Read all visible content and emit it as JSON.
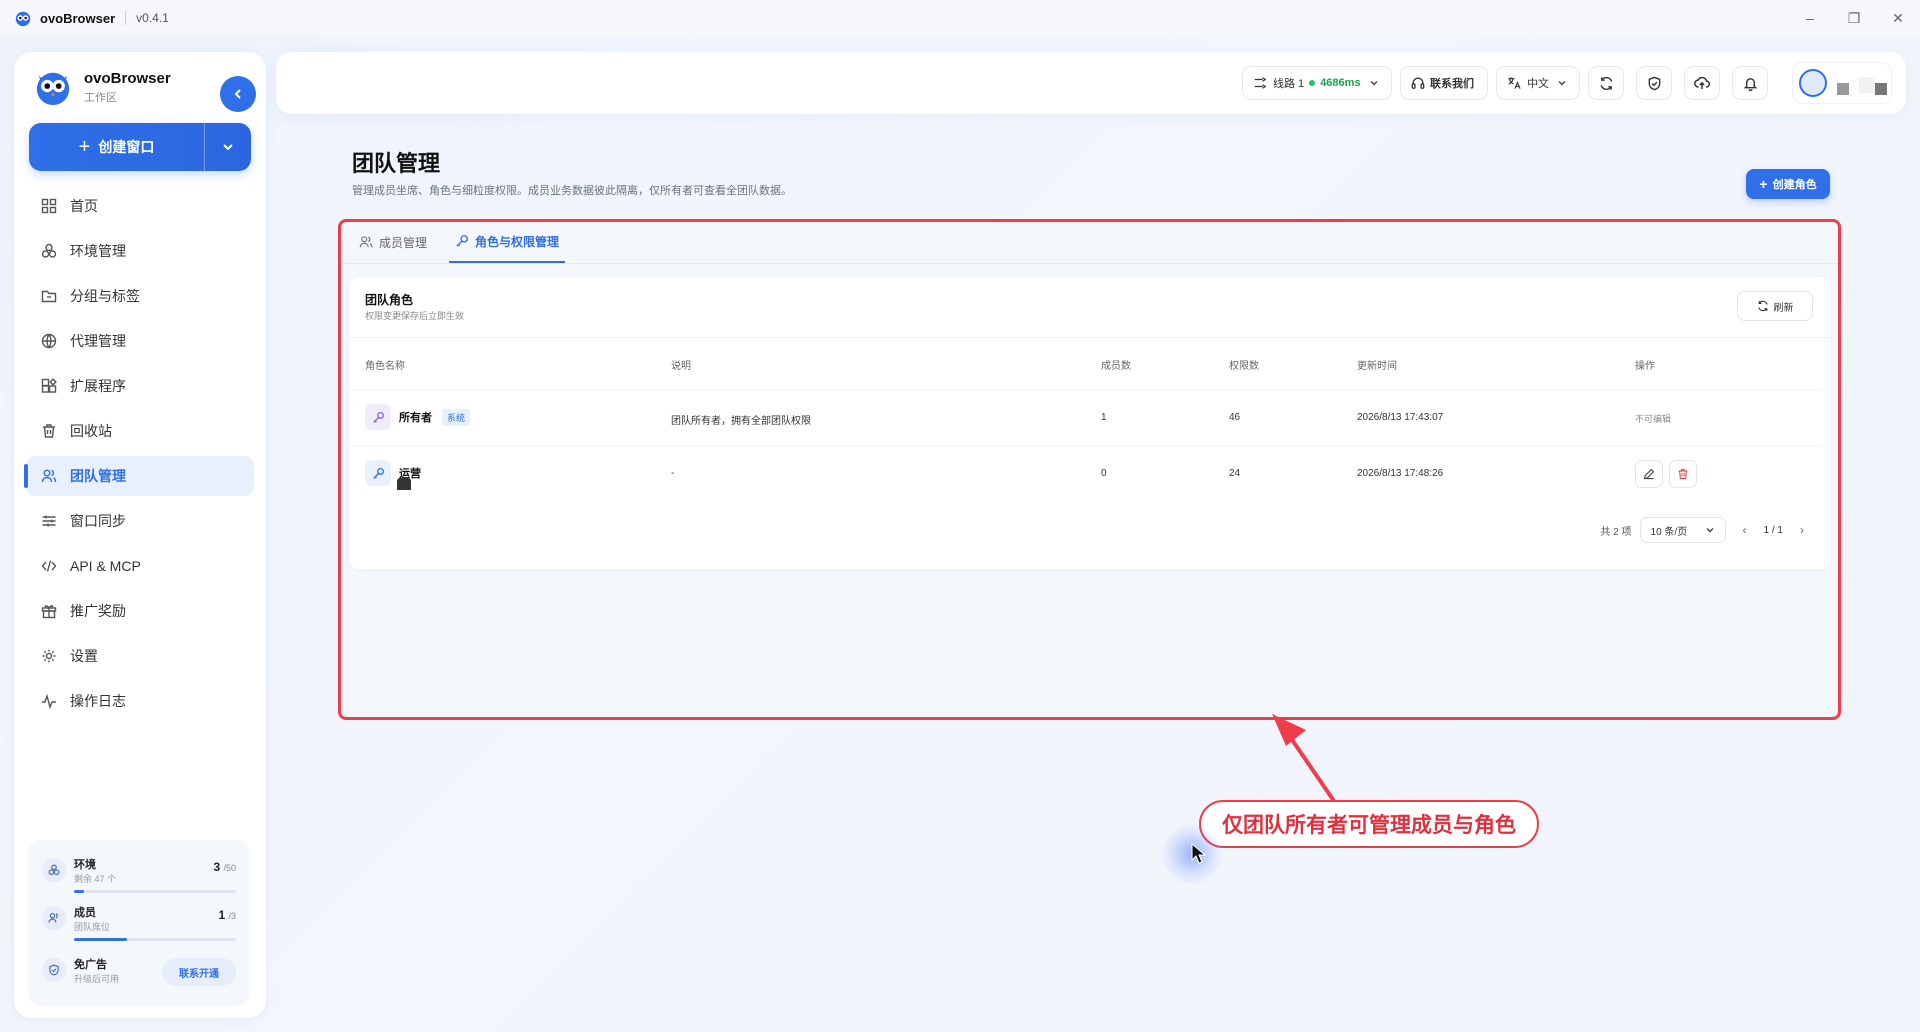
{
  "titlebar": {
    "app_name": "ovoBrowser",
    "version": "v0.4.1"
  },
  "sidebar": {
    "brand_name": "ovoBrowser",
    "brand_sub": "工作区",
    "create_window_label": "创建窗口",
    "items": [
      {
        "label": "首页",
        "icon": "grid-icon"
      },
      {
        "label": "环境管理",
        "icon": "cubes-icon"
      },
      {
        "label": "分组与标签",
        "icon": "folder-tag-icon"
      },
      {
        "label": "代理管理",
        "icon": "globe-icon"
      },
      {
        "label": "扩展程序",
        "icon": "puzzle-icon"
      },
      {
        "label": "回收站",
        "icon": "trash-icon"
      },
      {
        "label": "团队管理",
        "icon": "users-icon",
        "active": true
      },
      {
        "label": "窗口同步",
        "icon": "sliders-icon"
      },
      {
        "label": "API & MCP",
        "icon": "code-icon"
      },
      {
        "label": "推广奖励",
        "icon": "gift-icon"
      },
      {
        "label": "设置",
        "icon": "gear-icon"
      },
      {
        "label": "操作日志",
        "icon": "activity-icon"
      }
    ],
    "quota": {
      "env_label": "环境",
      "env_sub": "剩余 47 个",
      "env_used": "3",
      "env_total": "/50",
      "env_fraction": 0.06,
      "member_label": "成员",
      "member_sub": "团队席位",
      "member_used": "1",
      "member_total": "/3",
      "member_fraction": 0.33,
      "noad_label": "免广告",
      "noad_sub": "升级后可用",
      "contact_label": "联系开通"
    }
  },
  "topbar": {
    "line_label": "线路 1",
    "latency": "4686ms",
    "contact_label": "联系我们",
    "lang_label": "中文"
  },
  "page": {
    "title": "团队管理",
    "description": "管理成员坐席、角色与细粒度权限。成员业务数据彼此隔离，仅所有者可查看全团队数据。",
    "create_role_label": "创建角色",
    "tabs": [
      {
        "label": "成员管理",
        "active": false
      },
      {
        "label": "角色与权限管理",
        "active": true
      }
    ]
  },
  "roles_card": {
    "title": "团队角色",
    "subtitle": "权限变更保存后立即生效",
    "refresh_label": "刷新",
    "columns": [
      "角色名称",
      "说明",
      "成员数",
      "权限数",
      "更新时间",
      "操作"
    ],
    "rows": [
      {
        "name": "所有者",
        "badge": "系统",
        "desc": "团队所有者，拥有全部团队权限",
        "members": "1",
        "perms": "46",
        "updated": "2026/8/13 17:43:07",
        "action": "不可编辑"
      },
      {
        "name": "运营",
        "badge": "",
        "desc": "-",
        "members": "0",
        "perms": "24",
        "updated": "2026/8/13 17:48:26",
        "action": ""
      }
    ],
    "pager": {
      "total": "共 2 项",
      "page_size": "10 条/页",
      "page": "1 / 1"
    }
  },
  "annotation": {
    "callout": "仅团队所有者可管理成员与角色",
    "color": "#ef3d4b"
  }
}
